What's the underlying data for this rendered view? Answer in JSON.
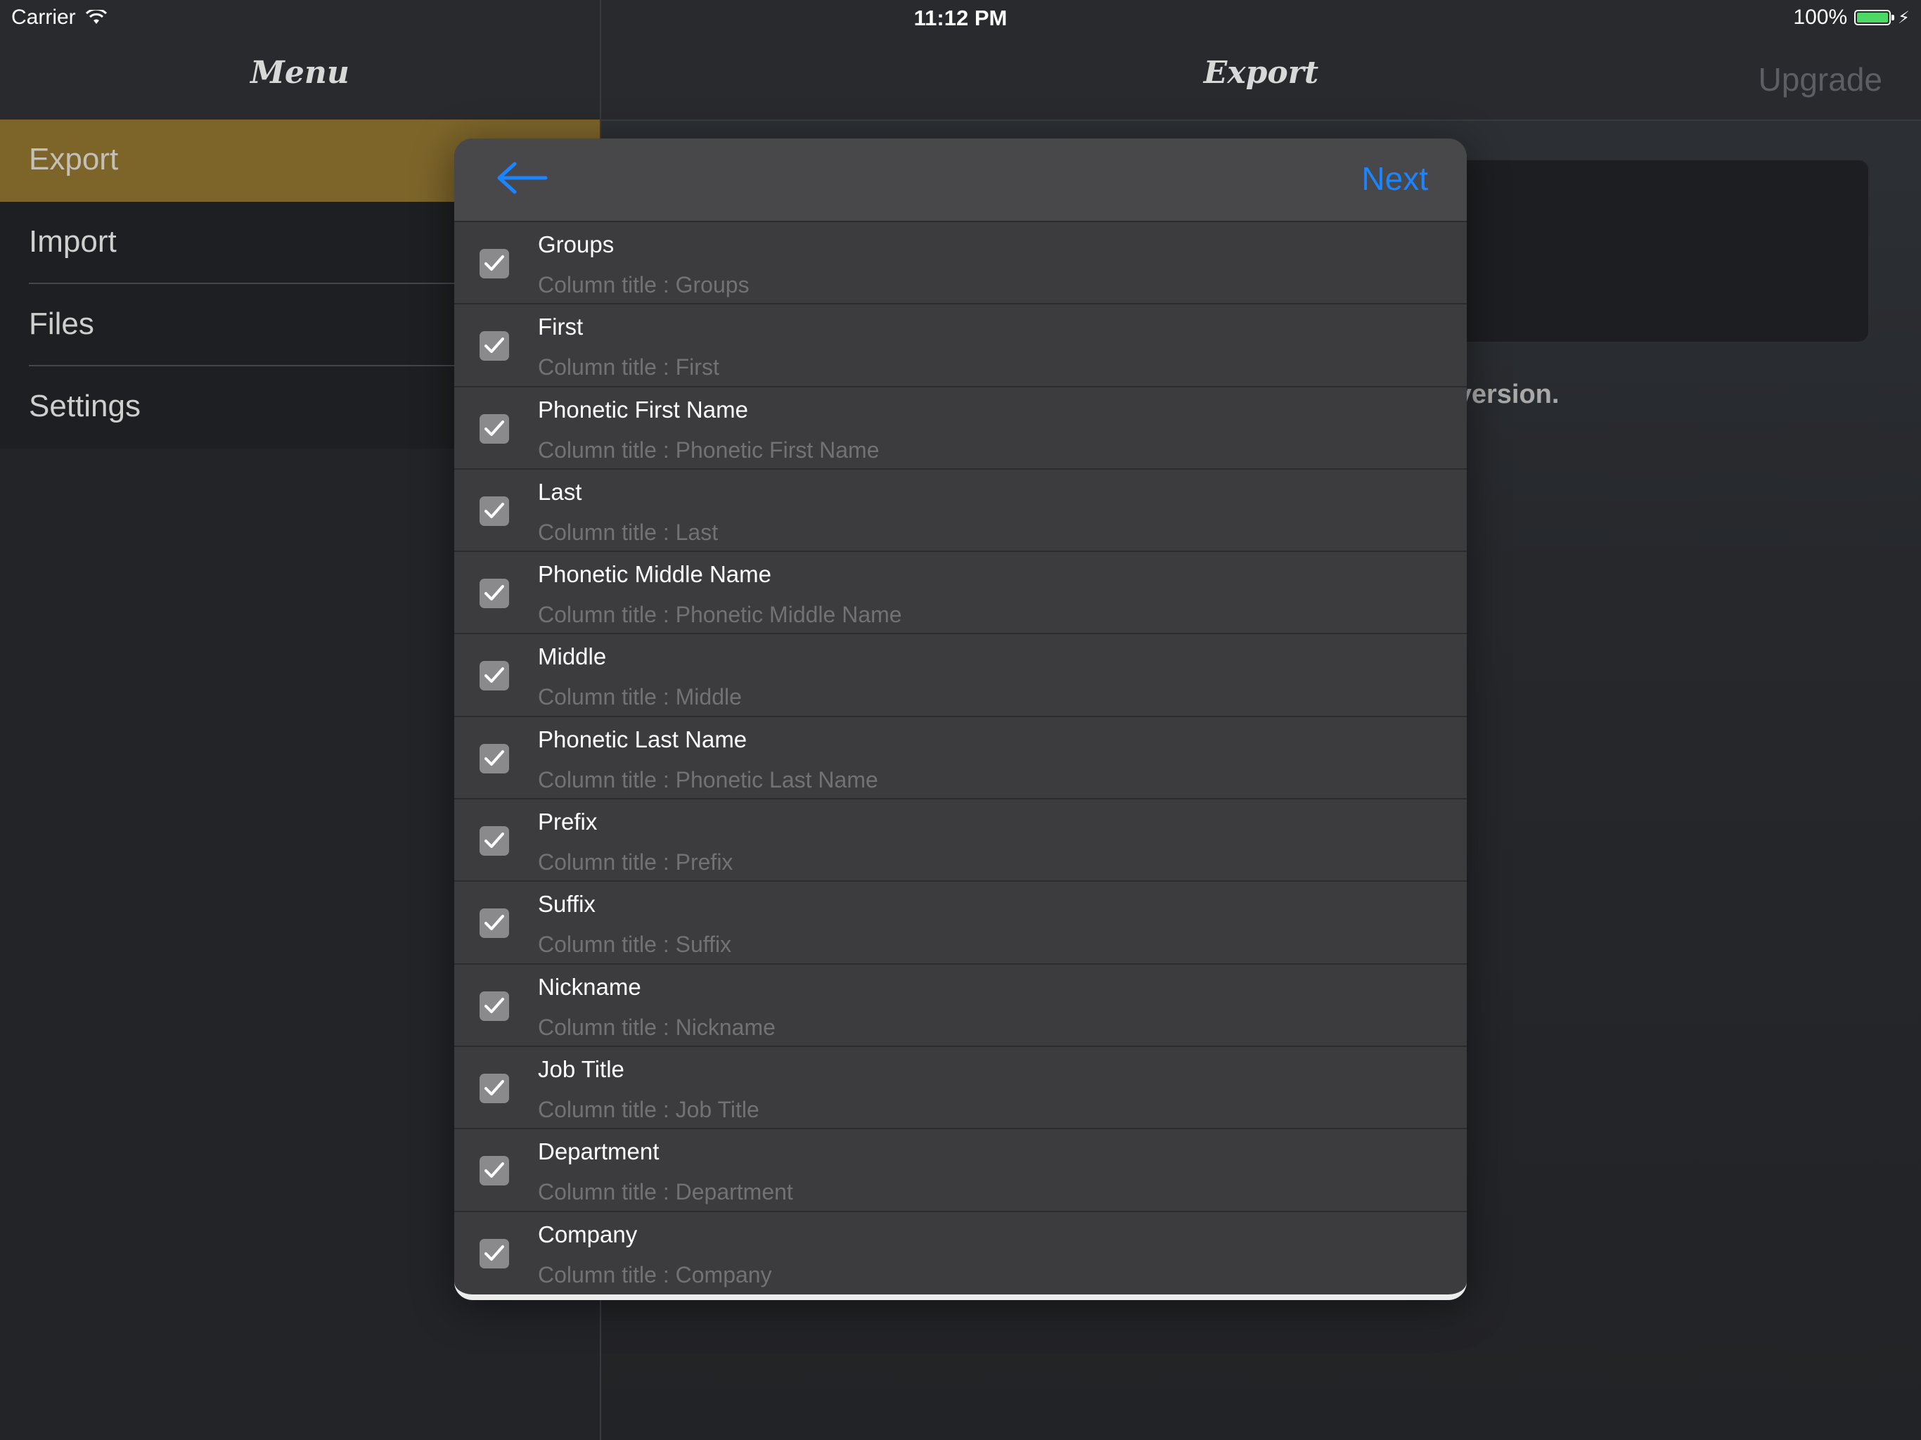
{
  "status_bar": {
    "carrier": "Carrier",
    "time": "11:12 PM",
    "battery": "100%",
    "battery_level": 1.0
  },
  "master": {
    "title": "Menu",
    "items": [
      {
        "label": "Export",
        "active": true
      },
      {
        "label": "Import",
        "active": false
      },
      {
        "label": "Files",
        "active": false
      },
      {
        "label": "Settings",
        "active": false
      }
    ]
  },
  "detail": {
    "title": "Export",
    "upgrade_label": "Upgrade",
    "note": "e version."
  },
  "modal": {
    "back_icon": "arrow-left-icon",
    "next_label": "Next",
    "rows": [
      {
        "title": "Groups",
        "subtitle": "Column title : Groups",
        "checked": true
      },
      {
        "title": "First",
        "subtitle": "Column title : First",
        "checked": true
      },
      {
        "title": "Phonetic First Name",
        "subtitle": "Column title : Phonetic First Name",
        "checked": true
      },
      {
        "title": "Last",
        "subtitle": "Column title : Last",
        "checked": true
      },
      {
        "title": "Phonetic Middle Name",
        "subtitle": "Column title : Phonetic Middle Name",
        "checked": true
      },
      {
        "title": "Middle",
        "subtitle": "Column title : Middle",
        "checked": true
      },
      {
        "title": "Phonetic Last Name",
        "subtitle": "Column title : Phonetic Last Name",
        "checked": true
      },
      {
        "title": "Prefix",
        "subtitle": "Column title : Prefix",
        "checked": true
      },
      {
        "title": "Suffix",
        "subtitle": "Column title : Suffix",
        "checked": true
      },
      {
        "title": "Nickname",
        "subtitle": "Column title : Nickname",
        "checked": true
      },
      {
        "title": "Job Title",
        "subtitle": "Column title : Job Title",
        "checked": true
      },
      {
        "title": "Department",
        "subtitle": "Column title : Department",
        "checked": true
      },
      {
        "title": "Company",
        "subtitle": "Column title : Company",
        "checked": true
      }
    ]
  },
  "colors": {
    "accent": "#1b85ff",
    "menu_active": "#7d652a",
    "battery": "#4cd964"
  }
}
